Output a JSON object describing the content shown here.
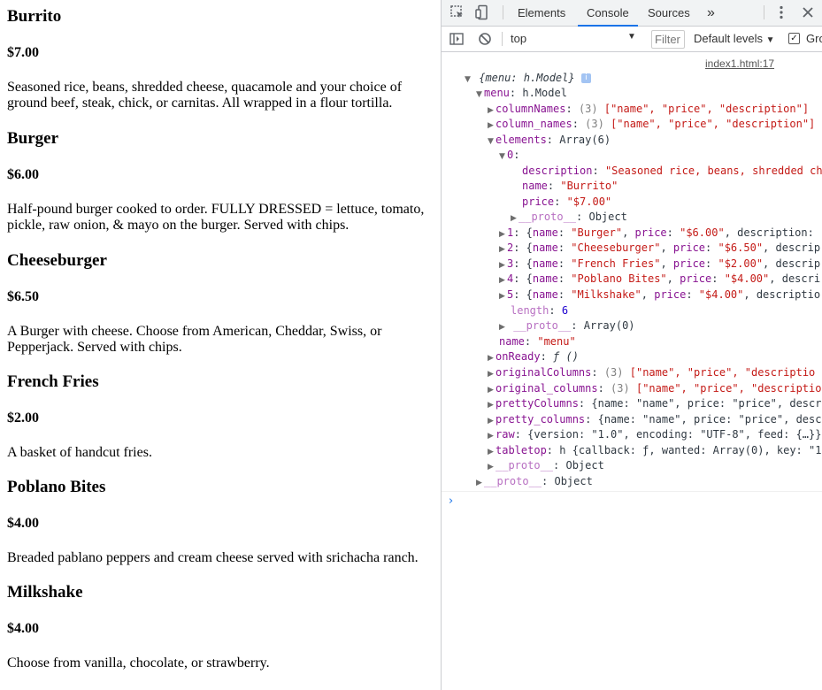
{
  "menu": [
    {
      "name": "Burrito",
      "price": "$7.00",
      "description": "Seasoned rice, beans, shredded cheese, quacamole and your choice of ground beef, steak, chick, or carnitas. All wrapped in a flour tortilla."
    },
    {
      "name": "Burger",
      "price": "$6.00",
      "description": "Half-pound burger cooked to order. FULLY DRESSED = lettuce, tomato, pickle, raw onion, & mayo on the burger. Served with chips."
    },
    {
      "name": "Cheeseburger",
      "price": "$6.50",
      "description": "A Burger with cheese. Choose from American, Cheddar, Swiss, or Pepperjack. Served with chips."
    },
    {
      "name": "French Fries",
      "price": "$2.00",
      "description": "A basket of handcut fries."
    },
    {
      "name": "Poblano Bites",
      "price": "$4.00",
      "description": "Breaded pablano peppers and cream cheese served with srichacha ranch."
    },
    {
      "name": "Milkshake",
      "price": "$4.00",
      "description": "Choose from vanilla, chocolate, or strawberry."
    }
  ],
  "devtools": {
    "tabs": {
      "elements": "Elements",
      "console": "Console",
      "sources": "Sources",
      "more": "»"
    },
    "context": "top",
    "filter_placeholder": "Filter",
    "levels": "Default levels",
    "group_label": "Gro",
    "source_link": "index1.html:17",
    "prompt": "›",
    "tree": {
      "root": "{menu: h.Model}",
      "menu_key": "menu",
      "menu_val": "h.Model",
      "columnNames": {
        "key": "columnNames",
        "count": "(3)",
        "val": "[\"name\", \"price\", \"description\"]"
      },
      "column_names": {
        "key": "column_names",
        "count": "(3)",
        "val": "[\"name\", \"price\", \"description\"]"
      },
      "elements": {
        "key": "elements",
        "val": "Array(6)"
      },
      "el0": {
        "key": "0",
        "description_key": "description",
        "description_val": "\"Seasoned rice, beans, shredded ch",
        "name_key": "name",
        "name_val": "\"Burrito\"",
        "price_key": "price",
        "price_val": "\"$7.00\"",
        "proto_key": "__proto__",
        "proto_val": "Object"
      },
      "summaries": [
        {
          "idx": "1",
          "name": "\"Burger\"",
          "price": "\"$6.00\"",
          "tail": ", description:"
        },
        {
          "idx": "2",
          "name": "\"Cheeseburger\"",
          "price": "\"$6.50\"",
          "tail": ", descrip"
        },
        {
          "idx": "3",
          "name": "\"French Fries\"",
          "price": "\"$2.00\"",
          "tail": ", descrip"
        },
        {
          "idx": "4",
          "name": "\"Poblano Bites\"",
          "price": "\"$4.00\"",
          "tail": ", descri"
        },
        {
          "idx": "5",
          "name": "\"Milkshake\"",
          "price": "\"$4.00\"",
          "tail": ", descriptio"
        }
      ],
      "length_key": "length",
      "length_val": "6",
      "arr_proto_key": "__proto__",
      "arr_proto_val": "Array(0)",
      "name_key": "name",
      "name_val": "\"menu\"",
      "onReady_key": "onReady",
      "onReady_val": "ƒ ()",
      "originalColumns": {
        "key": "originalColumns",
        "count": "(3)",
        "val": "[\"name\", \"price\", \"descriptio"
      },
      "original_columns": {
        "key": "original_columns",
        "count": "(3)",
        "val": "[\"name\", \"price\", \"descriptio"
      },
      "prettyColumns": {
        "key": "prettyColumns",
        "val": "{name: \"name\", price: \"price\", descr"
      },
      "pretty_columns": {
        "key": "pretty_columns",
        "val": "{name: \"name\", price: \"price\", desc"
      },
      "raw": {
        "key": "raw",
        "val": "{version: \"1.0\", encoding: \"UTF-8\", feed: {…}}"
      },
      "tabletop": {
        "key": "tabletop",
        "val": "h {callback: ƒ, wanted: Array(0), key: \"1"
      },
      "menu_proto_key": "__proto__",
      "menu_proto_val": "Object",
      "root_proto_key": "__proto__",
      "root_proto_val": "Object"
    }
  }
}
